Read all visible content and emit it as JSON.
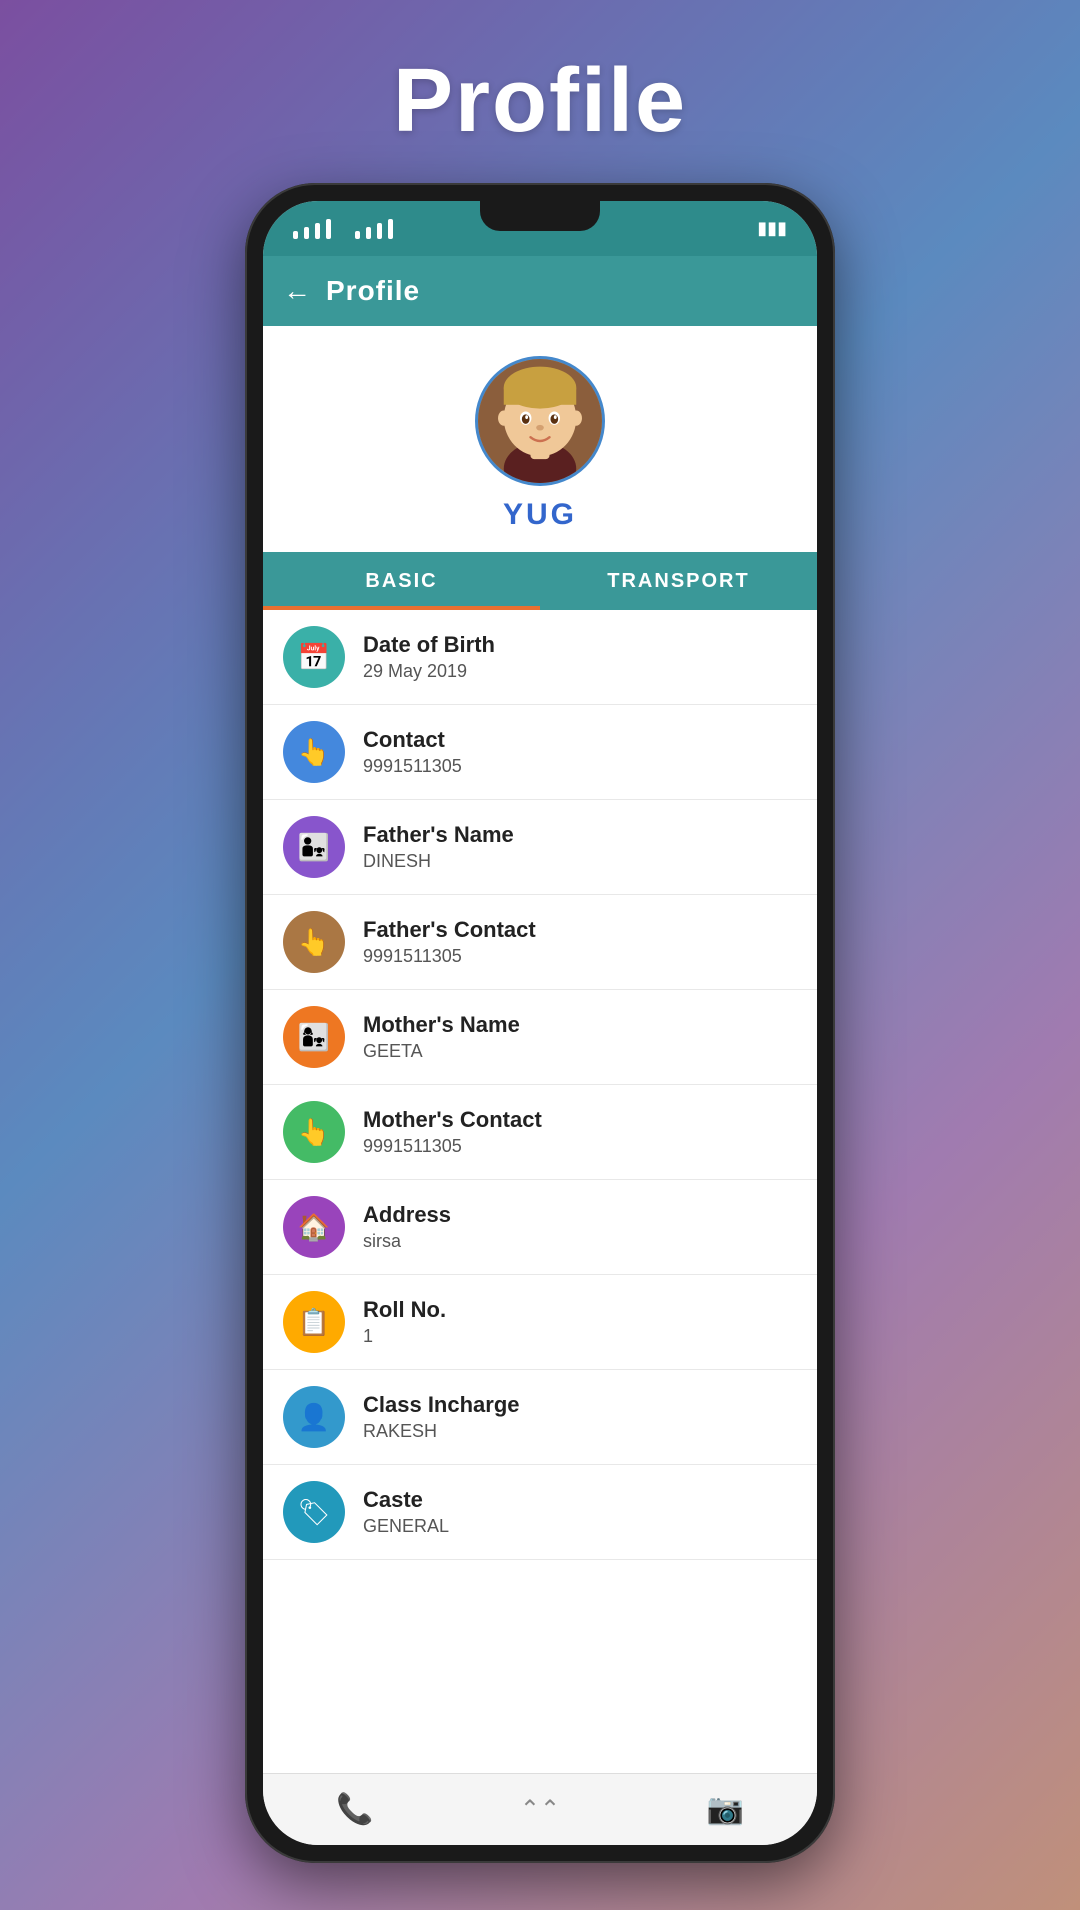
{
  "page": {
    "title": "Profile",
    "bg_gradient_start": "#7b4fa0",
    "bg_gradient_end": "#c0907a"
  },
  "app_bar": {
    "back_label": "←",
    "title": "Profile"
  },
  "tabs": [
    {
      "id": "basic",
      "label": "BASIC",
      "active": true
    },
    {
      "id": "transport",
      "label": "TRANSPORT",
      "active": false
    }
  ],
  "student": {
    "name": "YUG"
  },
  "profile_items": [
    {
      "id": "dob",
      "icon": "📅",
      "icon_color": "icon-teal",
      "label": "Date of Birth",
      "value": "29 May 2019"
    },
    {
      "id": "contact",
      "icon": "👆",
      "icon_color": "icon-blue",
      "label": "Contact",
      "value": "9991511305"
    },
    {
      "id": "father_name",
      "icon": "👨‍👧",
      "icon_color": "icon-purple",
      "label": "Father's Name",
      "value": "DINESH"
    },
    {
      "id": "father_contact",
      "icon": "👆",
      "icon_color": "icon-brown",
      "label": "Father's Contact",
      "value": "9991511305"
    },
    {
      "id": "mother_name",
      "icon": "👩‍👧",
      "icon_color": "icon-orange",
      "label": "Mother's Name",
      "value": "GEETA"
    },
    {
      "id": "mother_contact",
      "icon": "👆",
      "icon_color": "icon-green",
      "label": "Mother's Contact",
      "value": "9991511305"
    },
    {
      "id": "address",
      "icon": "🏠",
      "icon_color": "icon-violet",
      "label": "Address",
      "value": "sirsa"
    },
    {
      "id": "roll_no",
      "icon": "📋",
      "icon_color": "icon-amber",
      "label": "Roll No.",
      "value": "1"
    },
    {
      "id": "class_incharge",
      "icon": "👤",
      "icon_color": "icon-sky",
      "label": "Class Incharge",
      "value": "RAKESH"
    },
    {
      "id": "caste",
      "icon": "🏷",
      "icon_color": "icon-cyan",
      "label": "Caste",
      "value": "GENERAL"
    }
  ],
  "bottom_nav": {
    "phone_icon": "📞",
    "home_icon": "⌃⌃",
    "camera_icon": "📷"
  },
  "status_bar": {
    "battery": "▮▮▮"
  }
}
